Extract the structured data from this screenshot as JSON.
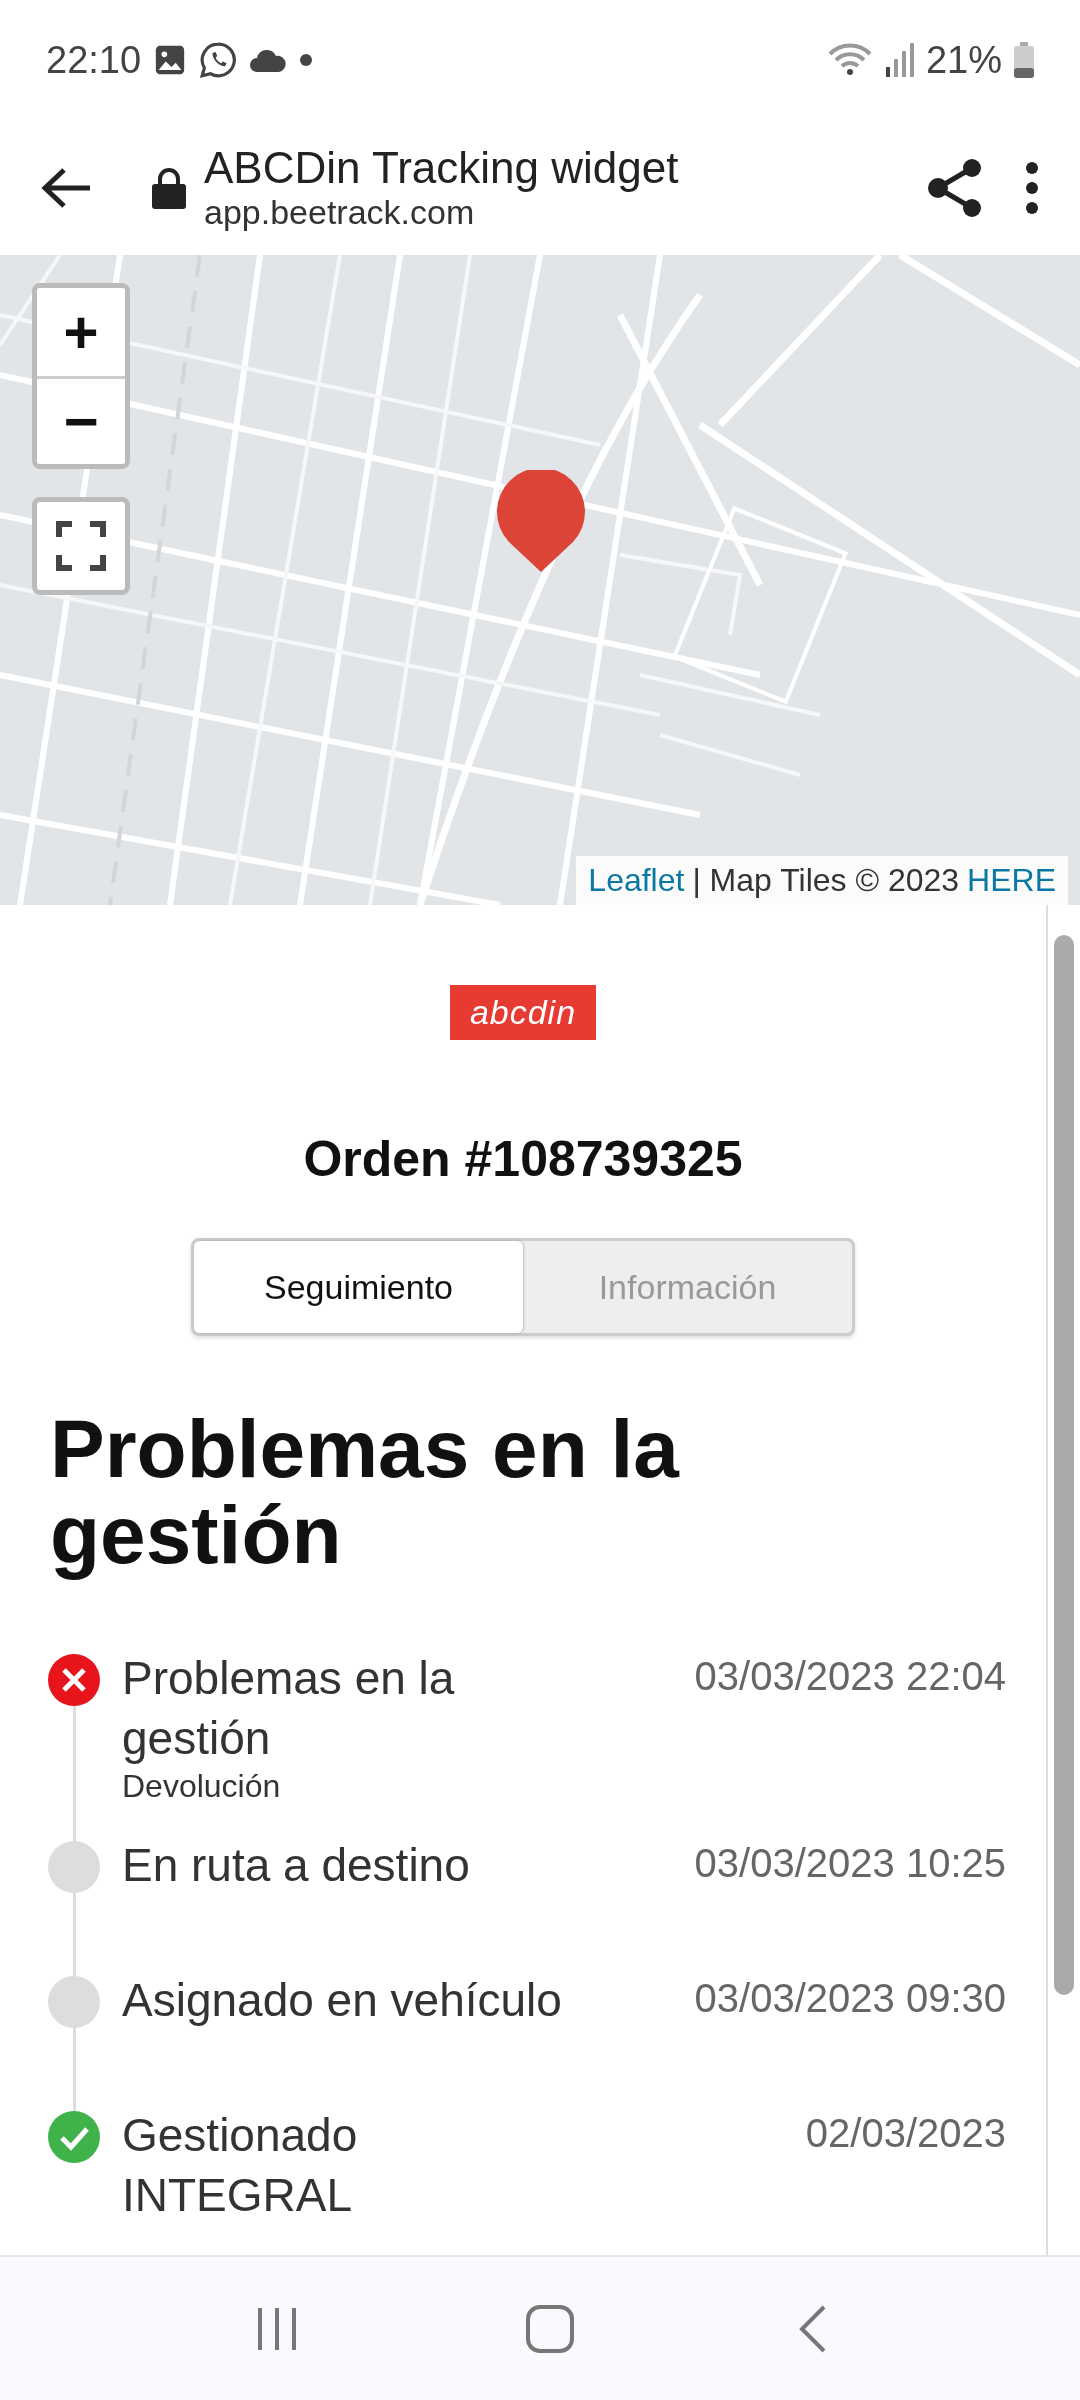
{
  "status_bar": {
    "time": "22:10",
    "battery": "21%"
  },
  "browser": {
    "title": "ABCDin Tracking widget",
    "url": "app.beetrack.com"
  },
  "map": {
    "zoom_in": "+",
    "zoom_out": "−",
    "attribution": {
      "link": "Leaflet",
      "text": "| Map Tiles © 2023",
      "provider": "HERE"
    }
  },
  "logo": "abcdin",
  "order_title": "Orden #108739325",
  "tabs": [
    {
      "label": "Seguimiento",
      "selected": true
    },
    {
      "label": "Información",
      "selected": false
    }
  ],
  "status_heading": "Problemas en la gestión",
  "timeline": [
    {
      "kind": "error",
      "title": "Problemas en la gestión",
      "subtitle": "Devolución",
      "date": "03/03/2023 22:04"
    },
    {
      "kind": "pending",
      "title": "En ruta a destino",
      "date": "03/03/2023 10:25"
    },
    {
      "kind": "pending",
      "title": "Asignado en vehículo",
      "date": "03/03/2023 09:30"
    },
    {
      "kind": "done",
      "title": "Gestionado INTEGRAL",
      "date": "02/03/2023"
    }
  ]
}
